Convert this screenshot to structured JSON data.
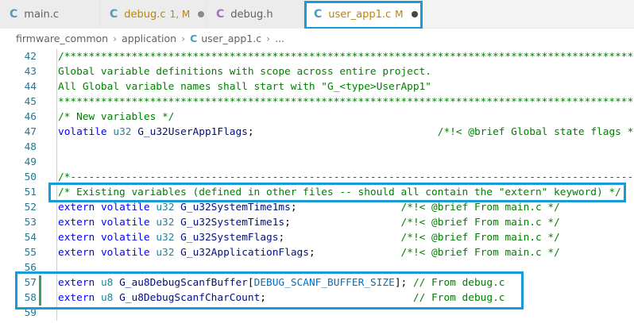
{
  "tabs": [
    {
      "name": "main.c",
      "icon": "c-file-icon",
      "status": "",
      "dirty": false,
      "active": false
    },
    {
      "name": "debug.c",
      "icon": "c-file-icon",
      "status": "1, M",
      "dirty": true,
      "active": false
    },
    {
      "name": "debug.h",
      "icon": "h-file-icon",
      "status": "",
      "dirty": false,
      "active": false
    },
    {
      "name": "user_app1.c",
      "icon": "c-file-icon",
      "status": "M",
      "dirty": true,
      "active": true
    }
  ],
  "icon_letters": {
    "c": "C",
    "h": "C"
  },
  "breadcrumb": {
    "folder1": "firmware_common",
    "folder2": "application",
    "file": "user_app1.c",
    "more": "...",
    "separator": "›"
  },
  "colors": {
    "highlight_box": "#1a9bd7",
    "comment": "#008000",
    "keyword": "#0000ff",
    "type": "#267f99",
    "variable": "#001080",
    "macro": "#0070c1",
    "line_number": "#237893",
    "modified": "#b8860b",
    "git_added": "#48985d"
  },
  "lines": [
    {
      "num": "42",
      "tokens": [
        [
          "cm",
          "/**********************************************************************************************************"
        ]
      ]
    },
    {
      "num": "43",
      "tokens": [
        [
          "cm",
          "Global variable definitions with scope across entire project."
        ]
      ]
    },
    {
      "num": "44",
      "tokens": [
        [
          "cm",
          "All Global variable names shall start with \"G_<type>UserApp1\""
        ]
      ]
    },
    {
      "num": "45",
      "tokens": [
        [
          "cm",
          "***********************************************************************************************************"
        ]
      ]
    },
    {
      "num": "46",
      "tokens": [
        [
          "cm",
          "/* New variables */"
        ]
      ]
    },
    {
      "num": "47",
      "tokens": [
        [
          "kw",
          "volatile"
        ],
        [
          "dm",
          " "
        ],
        [
          "ty",
          "u32"
        ],
        [
          "dm",
          " "
        ],
        [
          "va",
          "G_u32UserApp1Flags"
        ],
        [
          "dm",
          ";                              "
        ],
        [
          "cm",
          "/*!< @brief Global state flags */"
        ]
      ]
    },
    {
      "num": "48",
      "tokens": []
    },
    {
      "num": "49",
      "tokens": []
    },
    {
      "num": "50",
      "tokens": [
        [
          "cm",
          "/*--------------------------------------------------------------------------------------------------------"
        ]
      ]
    },
    {
      "num": "51",
      "tokens": [
        [
          "cm",
          "/* Existing variables (defined in other files -- should all contain the \"extern\" keyword) */"
        ]
      ]
    },
    {
      "num": "52",
      "tokens": [
        [
          "kw",
          "extern"
        ],
        [
          "dm",
          " "
        ],
        [
          "kw",
          "volatile"
        ],
        [
          "dm",
          " "
        ],
        [
          "ty",
          "u32"
        ],
        [
          "dm",
          " "
        ],
        [
          "va",
          "G_u32SystemTime1ms"
        ],
        [
          "dm",
          ";                 "
        ],
        [
          "cm",
          "/*!< @brief From main.c */"
        ]
      ]
    },
    {
      "num": "53",
      "tokens": [
        [
          "kw",
          "extern"
        ],
        [
          "dm",
          " "
        ],
        [
          "kw",
          "volatile"
        ],
        [
          "dm",
          " "
        ],
        [
          "ty",
          "u32"
        ],
        [
          "dm",
          " "
        ],
        [
          "va",
          "G_u32SystemTime1s"
        ],
        [
          "dm",
          ";                  "
        ],
        [
          "cm",
          "/*!< @brief From main.c */"
        ]
      ]
    },
    {
      "num": "54",
      "tokens": [
        [
          "kw",
          "extern"
        ],
        [
          "dm",
          " "
        ],
        [
          "kw",
          "volatile"
        ],
        [
          "dm",
          " "
        ],
        [
          "ty",
          "u32"
        ],
        [
          "dm",
          " "
        ],
        [
          "va",
          "G_u32SystemFlags"
        ],
        [
          "dm",
          ";                   "
        ],
        [
          "cm",
          "/*!< @brief From main.c */"
        ]
      ]
    },
    {
      "num": "55",
      "tokens": [
        [
          "kw",
          "extern"
        ],
        [
          "dm",
          " "
        ],
        [
          "kw",
          "volatile"
        ],
        [
          "dm",
          " "
        ],
        [
          "ty",
          "u32"
        ],
        [
          "dm",
          " "
        ],
        [
          "va",
          "G_u32ApplicationFlags"
        ],
        [
          "dm",
          ";              "
        ],
        [
          "cm",
          "/*!< @brief From main.c */"
        ]
      ]
    },
    {
      "num": "56",
      "tokens": []
    },
    {
      "num": "57",
      "tokens": [
        [
          "kw",
          "extern"
        ],
        [
          "dm",
          " "
        ],
        [
          "ty",
          "u8"
        ],
        [
          "dm",
          " "
        ],
        [
          "va",
          "G_au8DebugScanfBuffer"
        ],
        [
          "dm",
          "["
        ],
        [
          "mc",
          "DEBUG_SCANF_BUFFER_SIZE"
        ],
        [
          "dm",
          "]; "
        ],
        [
          "cm",
          "// From debug.c"
        ]
      ]
    },
    {
      "num": "58",
      "tokens": [
        [
          "kw",
          "extern"
        ],
        [
          "dm",
          " "
        ],
        [
          "ty",
          "u8"
        ],
        [
          "dm",
          " "
        ],
        [
          "va",
          "G_u8DebugScanfCharCount"
        ],
        [
          "dm",
          ";                        "
        ],
        [
          "cm",
          "// From debug.c"
        ]
      ]
    },
    {
      "num": "59",
      "tokens": []
    }
  ]
}
